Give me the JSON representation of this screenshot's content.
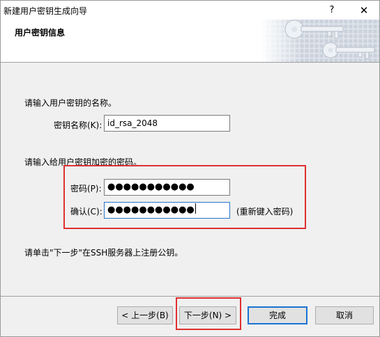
{
  "window": {
    "title": "新建用户密钥生成向导",
    "help_glyph": "?",
    "close_glyph": "✕"
  },
  "header": {
    "title": "用户密钥信息"
  },
  "form": {
    "name_prompt": "请输入用户密钥的名称。",
    "name_label": "密钥名称(K):",
    "name_value": "id_rsa_2048",
    "pass_prompt": "请输入给用户密钥加密的密码。",
    "password_label": "密码(P):",
    "password_mask": "●●●●●●●●●●●",
    "confirm_label": "确认(C):",
    "confirm_mask": "●●●●●●●●●●●",
    "confirm_hint": "(重新键入密码)",
    "note": "请单击\"下一步\"在SSH服务器上注册公钥。"
  },
  "buttons": {
    "back": "< 上一步(B)",
    "next": "下一步(N) >",
    "finish": "完成",
    "cancel": "取消"
  },
  "colors": {
    "highlight": "#e03030",
    "focus": "#1a73d1"
  }
}
